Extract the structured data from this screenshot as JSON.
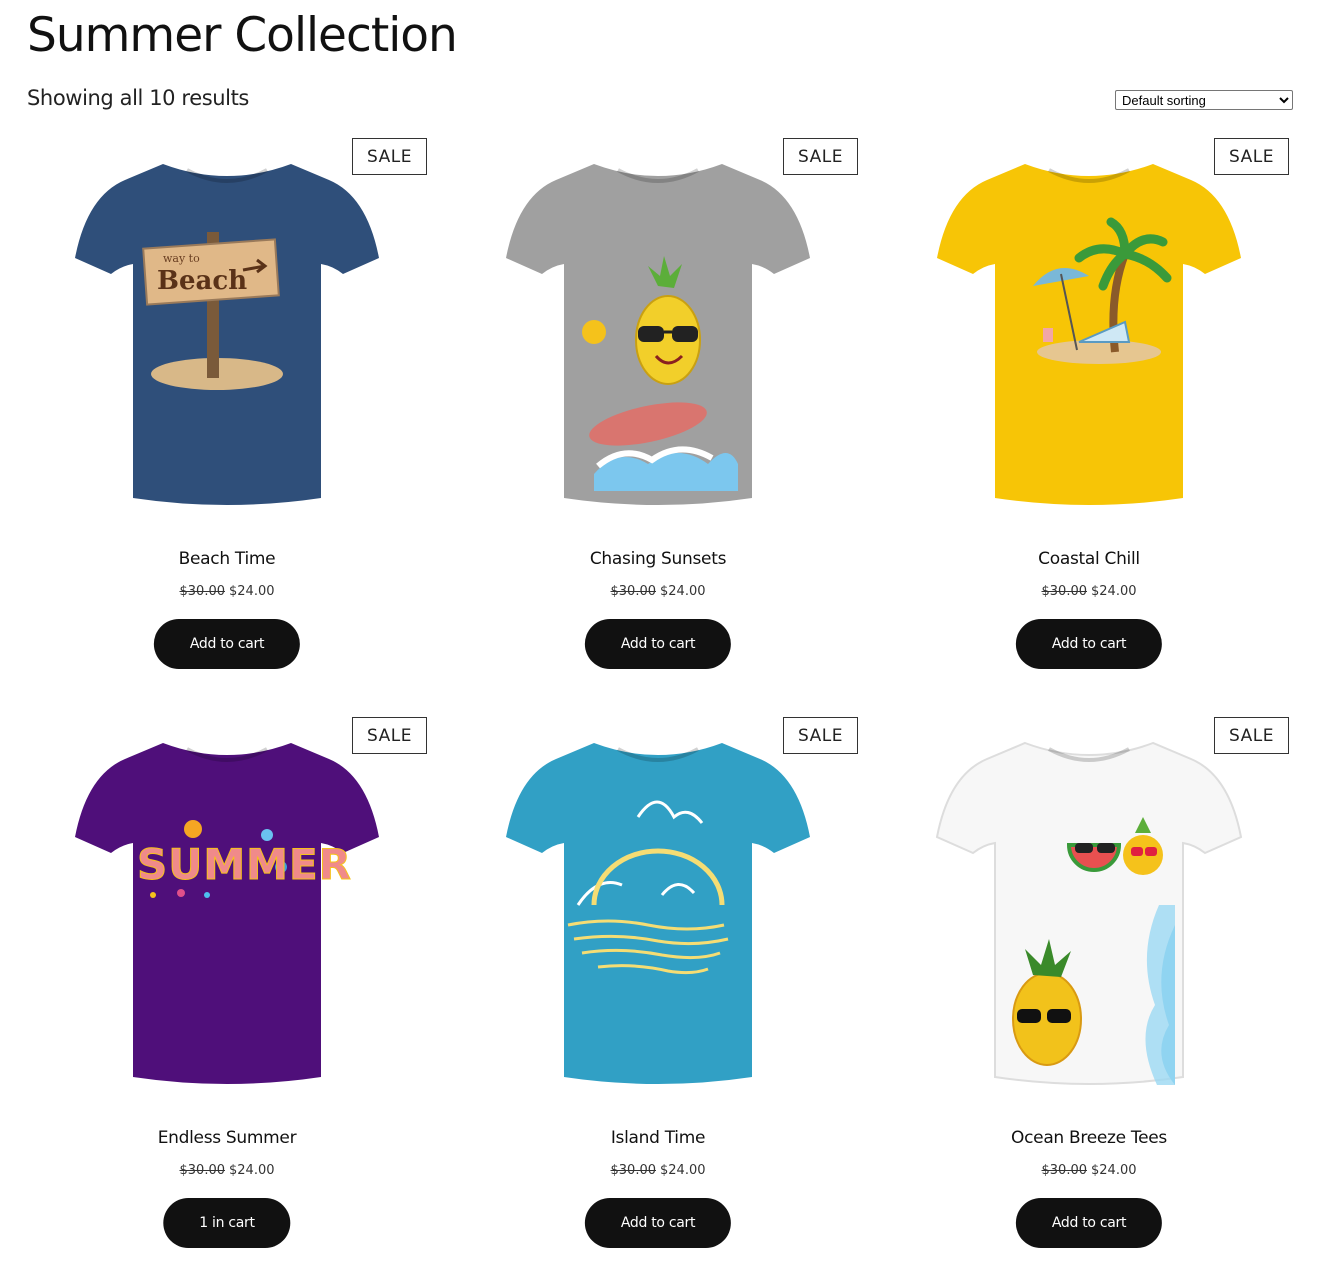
{
  "page": {
    "title": "Summer Collection",
    "result_count": "Showing all 10 results",
    "sorting": {
      "selected": "Default sorting",
      "options": [
        "Default sorting"
      ]
    }
  },
  "products": [
    {
      "name": "Beach Time",
      "badge": "SALE",
      "regular_price": "$30.00",
      "sale_price": "$24.00",
      "button": "Add to cart",
      "shirt_color": "#2f4f7a",
      "graphic": "beach-sign",
      "graphic_text": [
        "way to",
        "Beach"
      ]
    },
    {
      "name": "Chasing Sunsets",
      "badge": "SALE",
      "regular_price": "$30.00",
      "sale_price": "$24.00",
      "button": "Add to cart",
      "shirt_color": "#a0a0a0",
      "graphic": "surfing-pineapple"
    },
    {
      "name": "Coastal Chill",
      "badge": "SALE",
      "regular_price": "$30.00",
      "sale_price": "$24.00",
      "button": "Add to cart",
      "shirt_color": "#f7c506",
      "graphic": "beach-palm-umbrella"
    },
    {
      "name": "Endless Summer",
      "badge": "SALE",
      "regular_price": "$30.00",
      "sale_price": "$24.00",
      "button": "1 in cart",
      "shirt_color": "#4f0f7a",
      "graphic": "summer-lettering",
      "graphic_text": [
        "SUMMER"
      ]
    },
    {
      "name": "Island Time",
      "badge": "SALE",
      "regular_price": "$30.00",
      "sale_price": "$24.00",
      "button": "Add to cart",
      "shirt_color": "#31a0c5",
      "graphic": "sunset-waves-gulls"
    },
    {
      "name": "Ocean Breeze Tees",
      "badge": "SALE",
      "regular_price": "$30.00",
      "sale_price": "$24.00",
      "button": "Add to cart",
      "shirt_color": "#f7f7f7",
      "graphic": "fruits-and-wave"
    }
  ]
}
